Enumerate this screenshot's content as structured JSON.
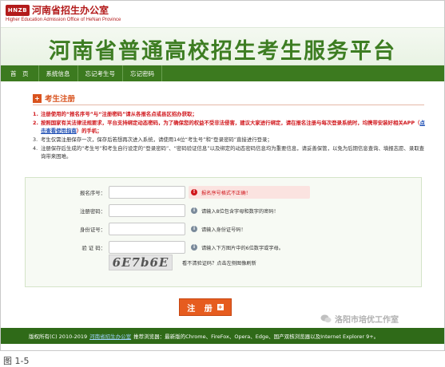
{
  "header": {
    "logo_mark": "HNZB",
    "logo_cn": "河南省招生办公室",
    "logo_en": "Higher Education Admission Office of HeNan Province"
  },
  "banner": {
    "title": "河南省普通高校招生考生服务平台"
  },
  "nav": {
    "items": [
      "首　页",
      "系统信息",
      "忘记考生号",
      "忘记密码"
    ]
  },
  "section": {
    "title": "考生注册",
    "icon": "plus-icon"
  },
  "notes": [
    {
      "num": "1.",
      "text": "注册使用的“报名序号”与“注册密码”请从各报名点或县区招办获取；",
      "red": true
    },
    {
      "num": "2.",
      "text": "按照国家有关法律法规要求，平台支持绑定动态密码，为了确保您的权益不受非法侵害，建议大家进行绑定，请在报名注册与每次登录系统时，均携带安装好相关APP（",
      "link": "点击查看使用指南",
      "text_after": "）的手机；",
      "red": true
    },
    {
      "num": "3.",
      "text": "考生仅需注册保存一次，保存后若想再次进入系统，请使用14位“考生号”和“登录密码”直接进行登录；",
      "red": false
    },
    {
      "num": "4.",
      "text": "注册保存后生成的“考生号”和考生自行设定的“登录密码”、“密码验证信息”以及绑定的动态密码信息均为重要信息，请妥善保管，以免为后期信息查询、填报志愿、录取查询带来困难。",
      "red": false
    }
  ],
  "form": {
    "fields": [
      {
        "label": "报名序号：",
        "value": "",
        "hint": "报名序号格式不正确！",
        "hint_type": "err"
      },
      {
        "label": "注册密码：",
        "value": "",
        "hint": "请输入8位包含字母和数字的密码！",
        "hint_type": "info"
      },
      {
        "label": "身份证号：",
        "value": "",
        "hint": "请输入身份证号码！",
        "hint_type": "info"
      },
      {
        "label": "验 证 码：",
        "value": "",
        "hint": "请输入下方图片中的6位数字或字母。",
        "hint_type": "info"
      }
    ],
    "captcha_text": "6E7b6E",
    "captcha_hint": "看不清验证码？点击左侧图像刷新"
  },
  "register_button": {
    "label": "注 册"
  },
  "footer": {
    "copyright": "版权所有(C) 2010-2019",
    "owner_link": "河南省招生办公室",
    "browser_text": "推荐浏览器：最新版的Chrome、FireFox、Opera、Edge、国产双核浏览器以及Internet Explorer 9+。"
  },
  "watermark": {
    "text": "洛阳市培优工作室"
  },
  "caption": "图 1-5"
}
